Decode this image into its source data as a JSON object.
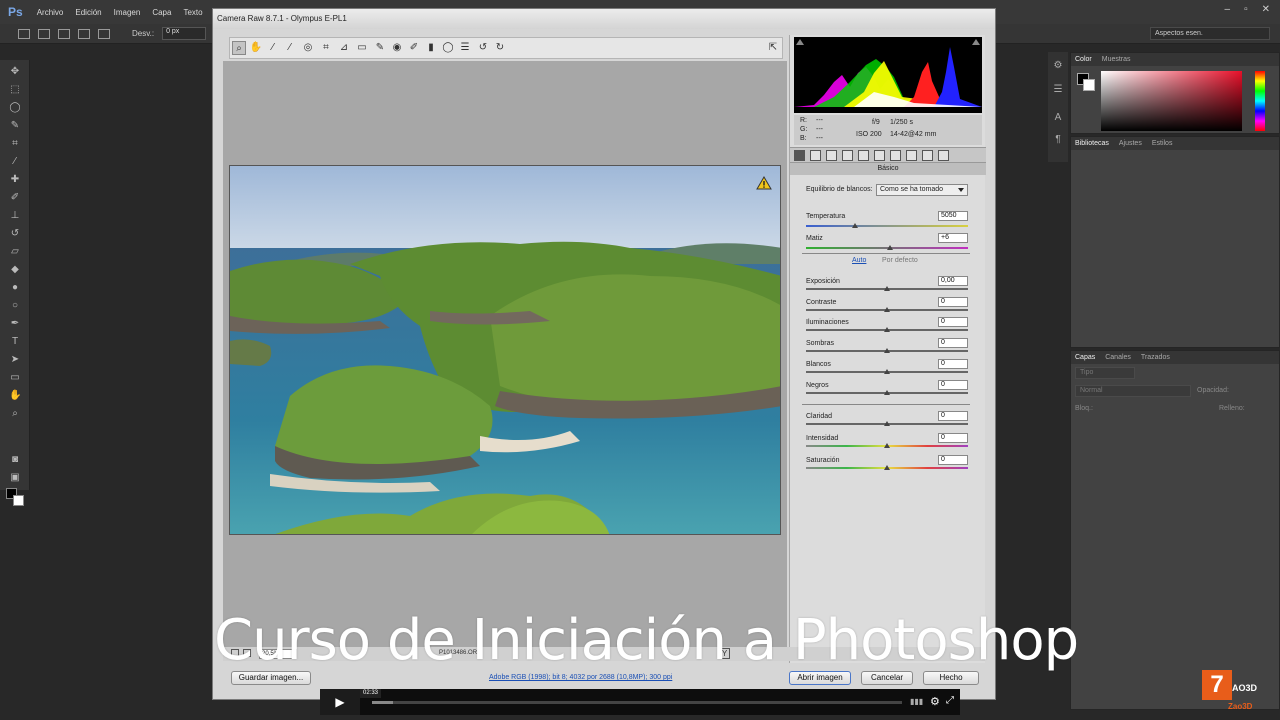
{
  "photoshop": {
    "logo": "Ps",
    "menu": [
      "Archivo",
      "Edición",
      "Imagen",
      "Capa",
      "Texto"
    ],
    "options": {
      "desv_label": "Desv.:",
      "desv_value": "0 px"
    },
    "workspace": "Aspectos esen.",
    "color_panel_tabs": [
      "Color",
      "Muestras"
    ],
    "library_tabs": [
      "Bibliotecas",
      "Ajustes",
      "Estilos"
    ],
    "layers_tabs": [
      "Capas",
      "Canales",
      "Trazados"
    ],
    "layers": {
      "filter": "Tipo",
      "blend_mode": "Normal",
      "opacity_label": "Opacidad:",
      "lock_label": "Bloq.:",
      "fill_label": "Relleno:"
    }
  },
  "camera_raw": {
    "title": "Camera Raw 8.7.1  -  Olympus E-PL1",
    "camera_info": {
      "r_label": "R:",
      "g_label": "G:",
      "b_label": "B:",
      "r_value": "---",
      "g_value": "---",
      "b_value": "---",
      "aperture": "f/9",
      "shutter": "1/250 s",
      "iso": "ISO 200",
      "lens": "14-42@42 mm"
    },
    "panel_title": "Básico",
    "white_balance": {
      "label": "Equilibrio de blancos:",
      "value": "Como se ha tomado"
    },
    "temperature": {
      "label": "Temperatura",
      "value": "5050",
      "pos": 0.3
    },
    "tint": {
      "label": "Matiz",
      "value": "+6",
      "pos": 0.52
    },
    "auto_link": "Auto",
    "default_link": "Por defecto",
    "tone_sliders": [
      {
        "label": "Exposición",
        "value": "0,00",
        "pos": 0.5
      },
      {
        "label": "Contraste",
        "value": "0",
        "pos": 0.5
      },
      {
        "label": "Iluminaciones",
        "value": "0",
        "pos": 0.5
      },
      {
        "label": "Sombras",
        "value": "0",
        "pos": 0.5
      },
      {
        "label": "Blancos",
        "value": "0",
        "pos": 0.5
      },
      {
        "label": "Negros",
        "value": "0",
        "pos": 0.5
      }
    ],
    "presence_sliders": [
      {
        "label": "Claridad",
        "value": "0",
        "pos": 0.5
      },
      {
        "label": "Intensidad",
        "value": "0",
        "pos": 0.5
      },
      {
        "label": "Saturación",
        "value": "0",
        "pos": 0.5
      }
    ],
    "zoom": "20,5%",
    "filename": "P1013486.ORF",
    "workflow_link": "Adobe RGB (1998); bit 8; 4032 por 2688 (10,8MP); 300 ppi",
    "buttons": {
      "save": "Guardar imagen...",
      "open": "Abrir imagen",
      "cancel": "Cancelar",
      "done": "Hecho"
    }
  },
  "video": {
    "current_time": "02:33",
    "progress": 0.04
  },
  "overlay_title": "Curso de Iniciación a Photoshop",
  "brand": {
    "mark": "7",
    "name": "AO3D",
    "sub": "Zao3D"
  },
  "colors": {
    "accent": "#e85d1a",
    "link": "#1a4fb5"
  }
}
